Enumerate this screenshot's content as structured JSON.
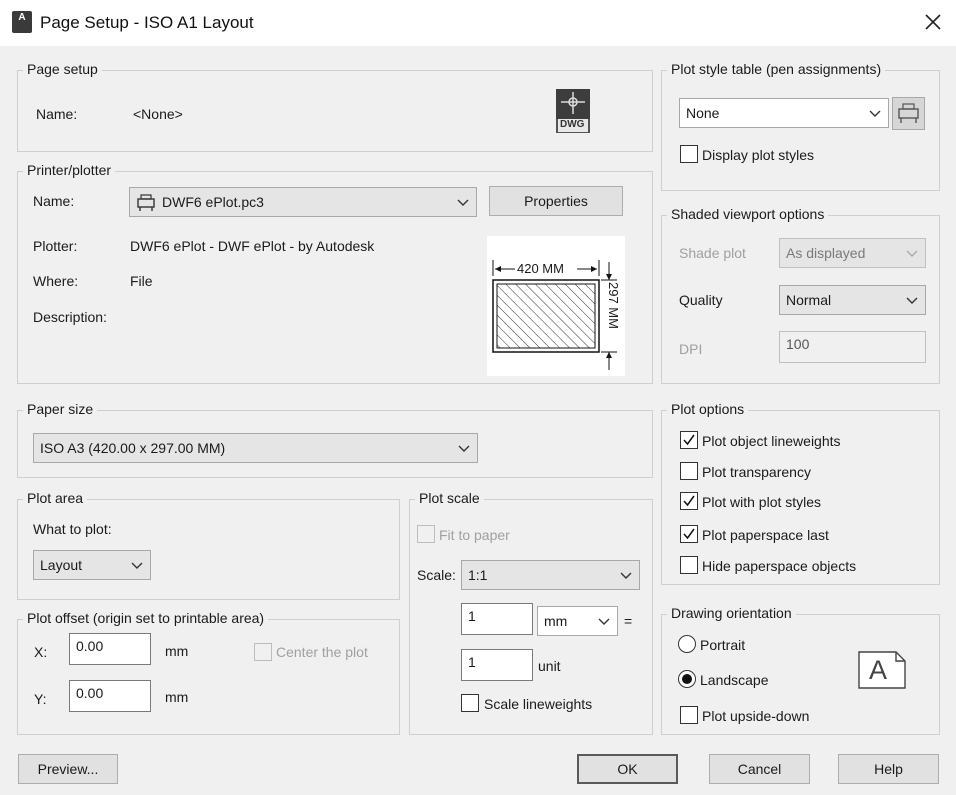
{
  "window": {
    "title": "Page Setup - ISO A1 Layout",
    "app_icon_label": "A",
    "close_icon": "close-icon"
  },
  "page_setup": {
    "legend": "Page setup",
    "name_label": "Name:",
    "name_value": "<None>",
    "dwg_icon_label": "DWG"
  },
  "printer": {
    "legend": "Printer/plotter",
    "name_label": "Name:",
    "name_value": "DWF6 ePlot.pc3",
    "properties_label": "Properties",
    "plotter_label": "Plotter:",
    "plotter_value": "DWF6 ePlot - DWF ePlot - by Autodesk",
    "where_label": "Where:",
    "where_value": "File",
    "description_label": "Description:",
    "preview_width_label": "420 MM",
    "preview_height_label": "297 MM"
  },
  "paper_size": {
    "legend": "Paper size",
    "value": "ISO A3 (420.00 x 297.00 MM)"
  },
  "plot_area": {
    "legend": "Plot area",
    "what_label": "What to plot:",
    "what_value": "Layout"
  },
  "plot_offset": {
    "legend": "Plot offset (origin set to printable area)",
    "x_label": "X:",
    "x_value": "0.00",
    "x_unit": "mm",
    "y_label": "Y:",
    "y_value": "0.00",
    "y_unit": "mm",
    "center_label": "Center the plot"
  },
  "plot_scale": {
    "legend": "Plot scale",
    "fit_label": "Fit to paper",
    "scale_label": "Scale:",
    "scale_value": "1:1",
    "value1": "1",
    "unit1": "mm",
    "equals": "=",
    "value2": "1",
    "unit2": "unit",
    "lineweights_label": "Scale lineweights"
  },
  "plot_style_table": {
    "legend": "Plot style table (pen assignments)",
    "value": "None",
    "display_label": "Display plot styles"
  },
  "shaded_viewport": {
    "legend": "Shaded viewport options",
    "shade_label": "Shade plot",
    "shade_value": "As displayed",
    "quality_label": "Quality",
    "quality_value": "Normal",
    "dpi_label": "DPI",
    "dpi_value": "100"
  },
  "plot_options": {
    "legend": "Plot options",
    "items": [
      {
        "label": "Plot object lineweights",
        "checked": true
      },
      {
        "label": "Plot transparency",
        "checked": false
      },
      {
        "label": "Plot with plot styles",
        "checked": true
      },
      {
        "label": "Plot paperspace last",
        "checked": true
      },
      {
        "label": "Hide paperspace objects",
        "checked": false
      }
    ]
  },
  "orientation": {
    "legend": "Drawing orientation",
    "portrait_label": "Portrait",
    "landscape_label": "Landscape",
    "upside_label": "Plot upside-down",
    "selected": "landscape",
    "icon_letter": "A"
  },
  "footer": {
    "preview_label": "Preview...",
    "ok_label": "OK",
    "cancel_label": "Cancel",
    "help_label": "Help"
  }
}
